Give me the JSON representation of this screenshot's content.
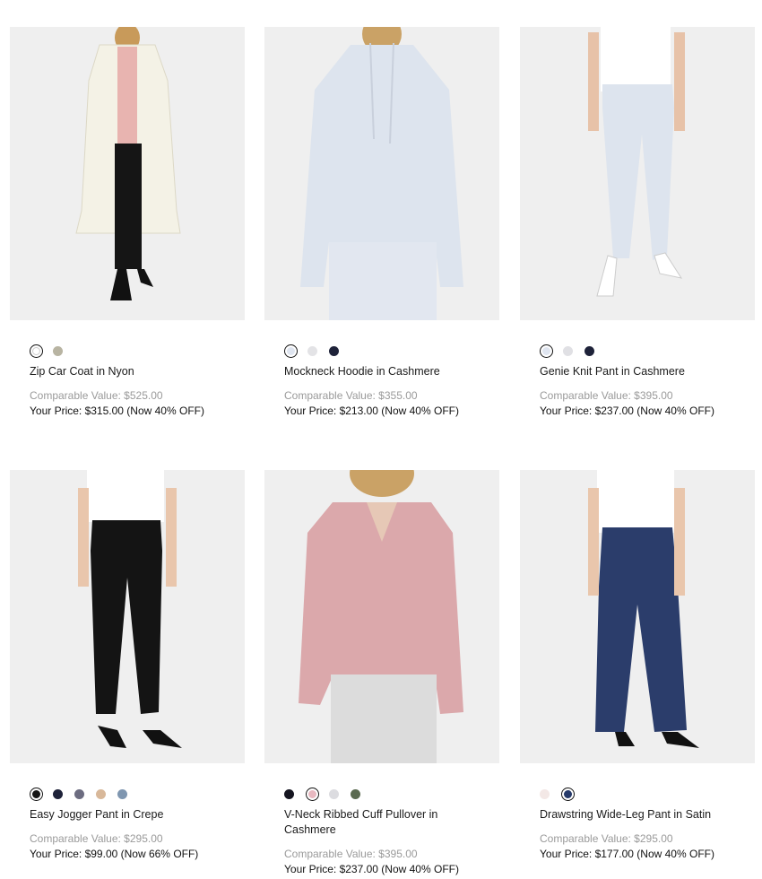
{
  "products": [
    {
      "name": "Zip Car Coat in Nyon",
      "comparable": "Comparable Value: $525.00",
      "price": "Your Price: $315.00 (Now 40% OFF)",
      "swatches": [
        "#ffffff",
        "#b8b4a2"
      ],
      "selected": 0
    },
    {
      "name": "Mockneck Hoodie in Cashmere",
      "comparable": "Comparable Value: $355.00",
      "price": "Your Price: $213.00 (Now 40% OFF)",
      "swatches": [
        "#dfe5f0",
        "#e3e3e6",
        "#1e2239"
      ],
      "selected": 0
    },
    {
      "name": "Genie Knit Pant in Cashmere",
      "comparable": "Comparable Value: $395.00",
      "price": "Your Price: $237.00 (Now 40% OFF)",
      "swatches": [
        "#dfe5f0",
        "#e0e0e4",
        "#1e2239"
      ],
      "selected": 0
    },
    {
      "name": "Easy Jogger Pant in Crepe",
      "comparable": "Comparable Value: $295.00",
      "price": "Your Price: $99.00 (Now 66% OFF)",
      "swatches": [
        "#151515",
        "#1e2239",
        "#6c6c80",
        "#d8b89a",
        "#7f96b0"
      ],
      "selected": 0
    },
    {
      "name": "V-Neck Ribbed Cuff Pullover in Cashmere",
      "comparable": "Comparable Value: $395.00",
      "price": "Your Price: $237.00 (Now 40% OFF)",
      "swatches": [
        "#151520",
        "#e8b8c0",
        "#dcdce0",
        "#5a6a50"
      ],
      "selected": 1
    },
    {
      "name": "Drawstring Wide-Leg Pant in Satin",
      "comparable": "Comparable Value: $295.00",
      "price": "Your Price: $177.00 (Now 40% OFF)",
      "swatches": [
        "#f3e8e6",
        "#263a6a"
      ],
      "selected": 1
    }
  ]
}
